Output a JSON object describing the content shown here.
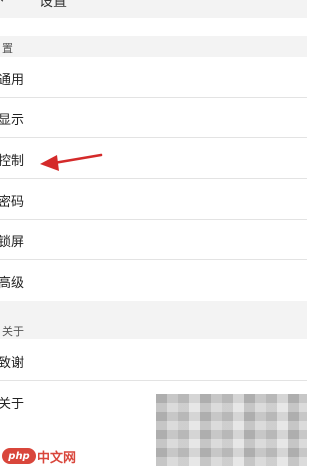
{
  "header": {
    "back_glyph": "←",
    "title": "设置"
  },
  "sections": [
    {
      "title": "置",
      "items": [
        {
          "label": "通用"
        },
        {
          "label": "显示"
        },
        {
          "label": "控制"
        },
        {
          "label": "密码"
        },
        {
          "label": "锁屏"
        },
        {
          "label": "高级"
        }
      ]
    },
    {
      "title": "关于",
      "items": [
        {
          "label": "致谢"
        },
        {
          "label": "关于"
        }
      ]
    }
  ],
  "annotation": {
    "icon": "red-arrow-icon",
    "color": "#d42a2a",
    "points_to": "控制"
  },
  "watermark": {
    "logo_text": "php",
    "site_text": "中文网",
    "color": "#d9463b"
  }
}
